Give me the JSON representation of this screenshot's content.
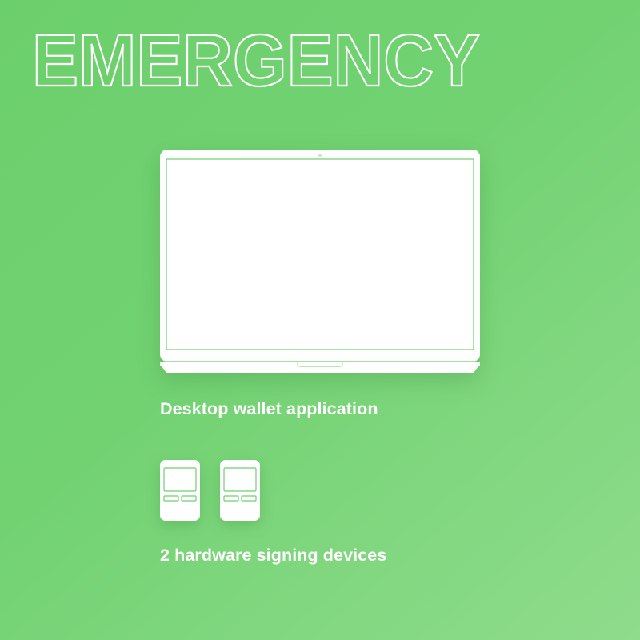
{
  "headline": {
    "text": "EMERGENCY"
  },
  "desktop": {
    "icon": "laptop-icon",
    "caption": "Desktop wallet application"
  },
  "devices": {
    "icon": "hardware-device-icon",
    "count": 2,
    "caption": "2 hardware signing devices"
  },
  "colors": {
    "background_start": "#6bcf6b",
    "background_end": "#8fdc8c",
    "foreground": "#ffffff",
    "accent_line": "#6ecf6e"
  }
}
